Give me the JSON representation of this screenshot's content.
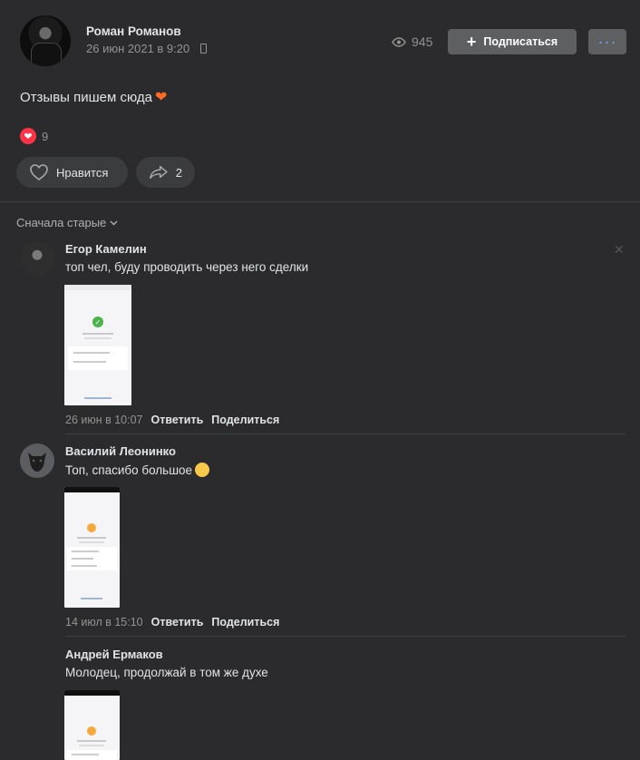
{
  "post": {
    "author": "Роман Романов",
    "date": "26 июн 2021 в 9:20",
    "views": "945",
    "subscribe_label": "Подписаться",
    "more_label": "···",
    "text": "Отзывы пишем сюда",
    "text_emoji": "❤",
    "reactions_count": "9",
    "like_label": "Нравится",
    "share_count": "2"
  },
  "comments_section": {
    "sort_label": "Сначала старые"
  },
  "comments": [
    {
      "author": "Егор Камелин",
      "text": "топ чел, буду проводить через него сделки",
      "date": "26 июн в 10:07",
      "reply_label": "Ответить",
      "share_label": "Поделиться"
    },
    {
      "author": "Василий Леонинко",
      "text": "Топ, спасибо большое",
      "date": "14 июл в 15:10",
      "reply_label": "Ответить",
      "share_label": "Поделиться"
    },
    {
      "author": "Андрей Ермаков",
      "text": "Молодец, продолжай в том же духе"
    }
  ],
  "colors": {
    "background": "#2b2b2d",
    "button_bg": "#5d5f61",
    "accent_link": "#71aaeb",
    "reaction_red": "#ff3347",
    "heart_orange": "#ff6b24"
  }
}
